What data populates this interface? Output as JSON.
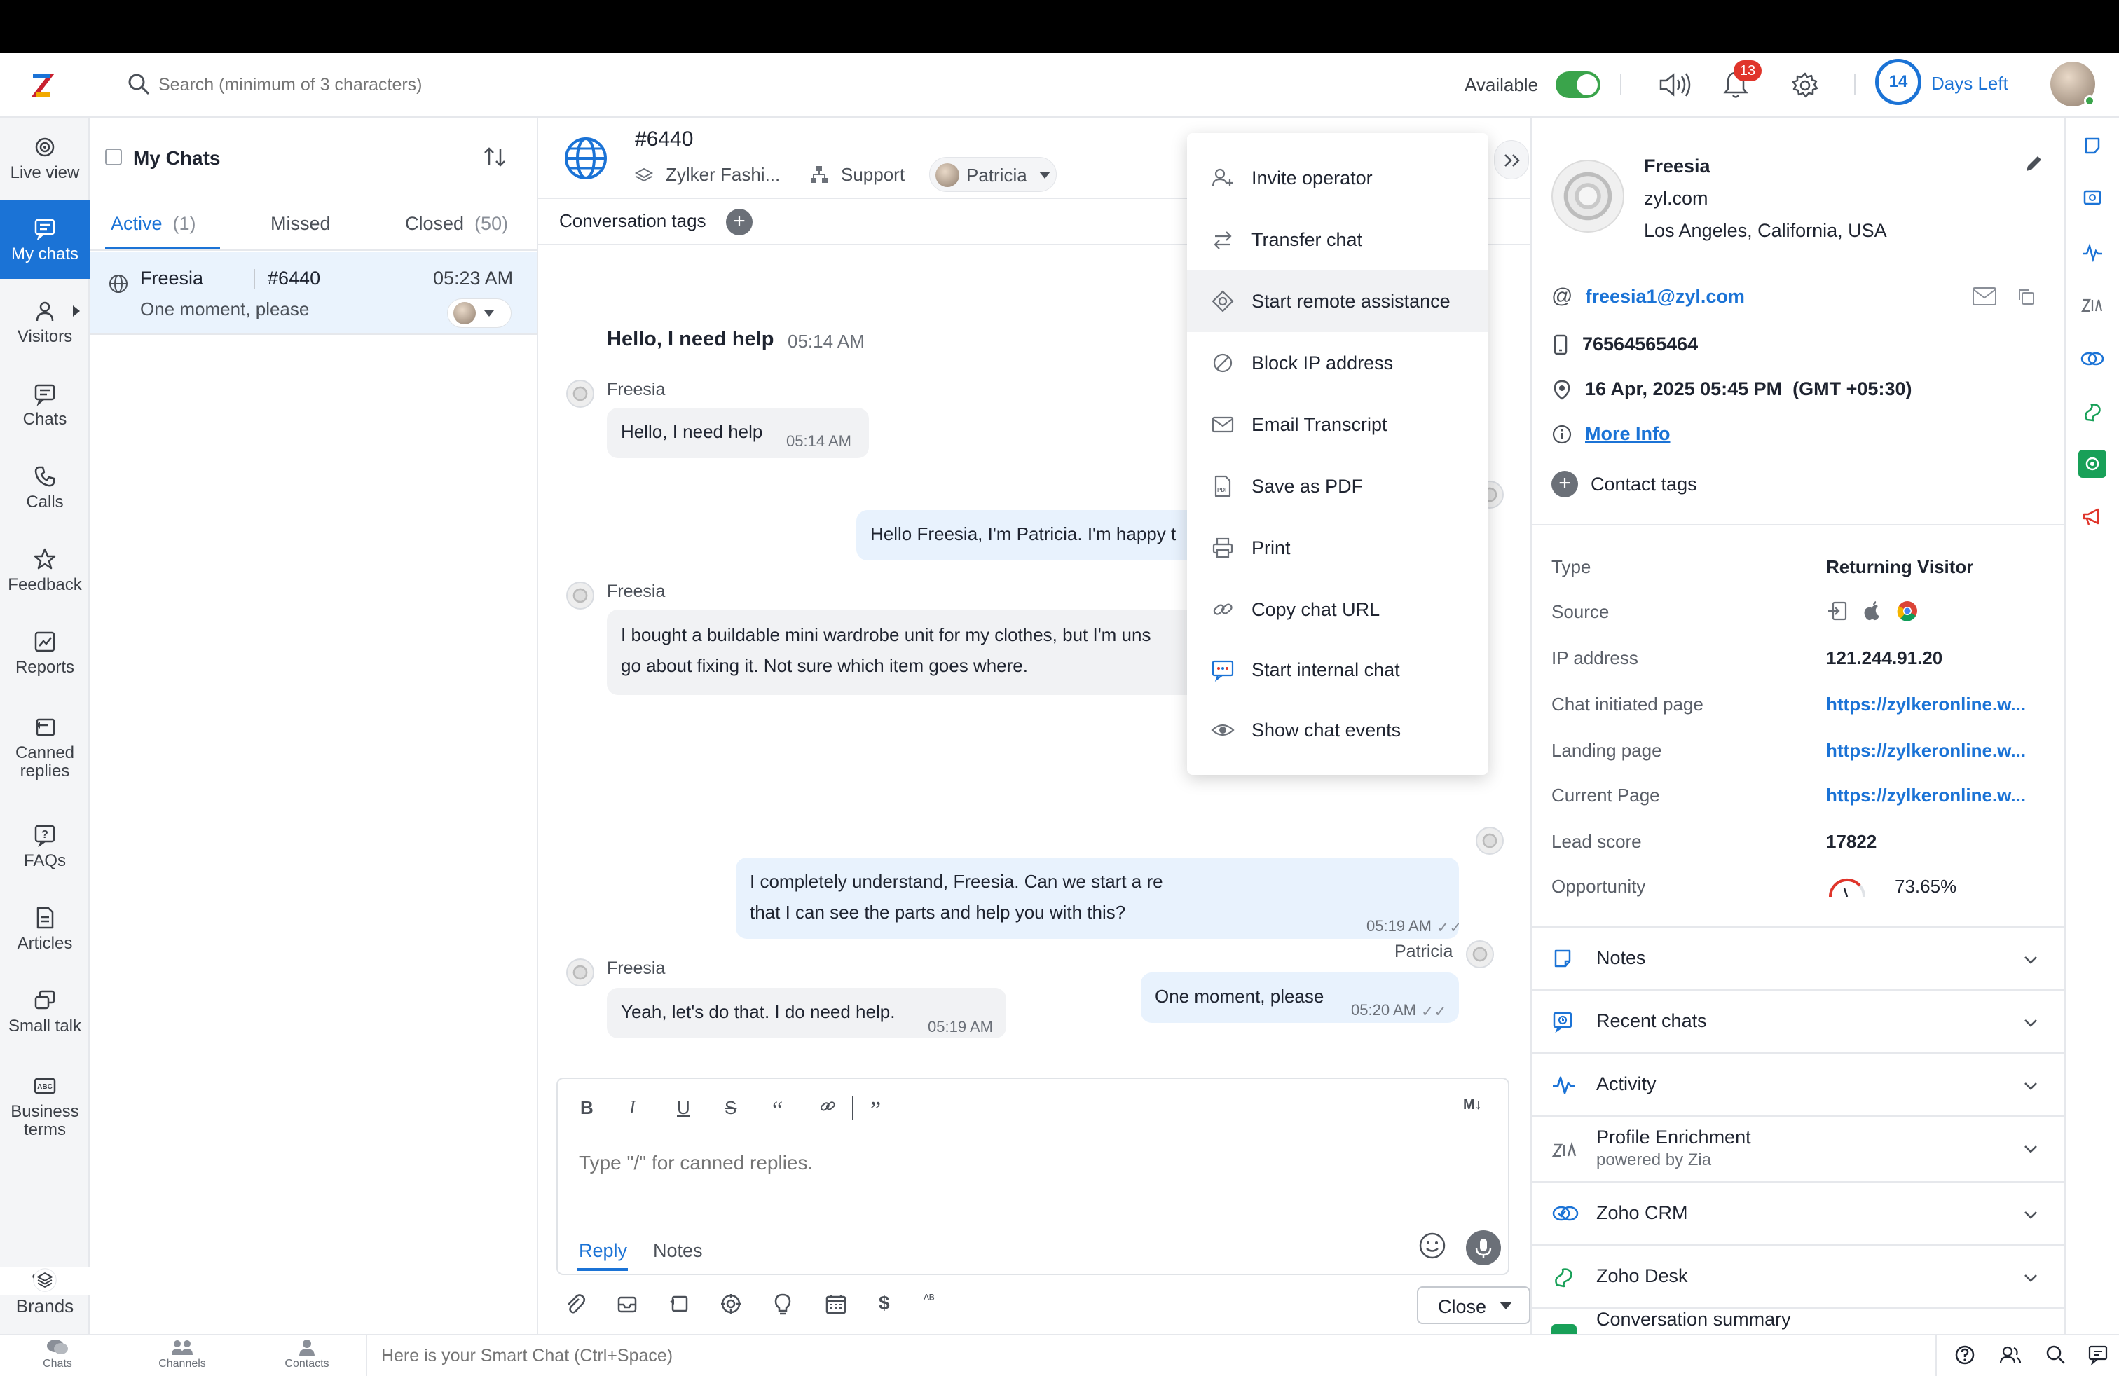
{
  "header": {
    "search_placeholder": "Search (minimum of 3 characters)",
    "availability_label": "Available",
    "notification_count": "13",
    "trial_days": "14",
    "trial_label": "Days Left"
  },
  "nav": {
    "items": [
      {
        "label": "Live view",
        "icon": "live-view-icon"
      },
      {
        "label": "My chats",
        "icon": "chat-bubble-icon"
      },
      {
        "label": "Visitors",
        "icon": "person-icon"
      },
      {
        "label": "Chats",
        "icon": "chats-icon"
      },
      {
        "label": "Calls",
        "icon": "phone-icon"
      },
      {
        "label": "Feedback",
        "icon": "star-icon"
      },
      {
        "label": "Reports",
        "icon": "chart-icon"
      },
      {
        "label": "Canned replies",
        "icon": "canned-reply-icon"
      },
      {
        "label": "FAQs",
        "icon": "faq-icon"
      },
      {
        "label": "Articles",
        "icon": "article-icon"
      },
      {
        "label": "Small talk",
        "icon": "small-talk-icon"
      },
      {
        "label": "Business terms",
        "icon": "abc-icon"
      }
    ],
    "more": "•••",
    "brands": "Brands"
  },
  "chatlist": {
    "title": "My Chats",
    "tabs": [
      {
        "label": "Active",
        "count": "(1)"
      },
      {
        "label": "Missed",
        "count": ""
      },
      {
        "label": "Closed",
        "count": "(50)"
      }
    ],
    "rows": [
      {
        "name": "Freesia",
        "id": "#6440",
        "time": "05:23 AM",
        "message": "One moment, please"
      }
    ]
  },
  "conversation": {
    "id": "#6440",
    "department": "Zylker Fashi...",
    "support": "Support",
    "assignee": "Patricia",
    "tags_label": "Conversation tags",
    "first_question": "Hello, I need help",
    "first_question_time": "05:14 AM",
    "messages": [
      {
        "sender": "Freesia",
        "text": "Hello, I need help",
        "time": "05:14 AM"
      },
      {
        "text": "Hello Freesia, I'm Patricia. I'm happy t"
      },
      {
        "sender": "Freesia",
        "text1": "I bought a buildable mini wardrobe unit for my clothes, but I'm uns",
        "text2": "go about fixing it. Not sure which item goes where."
      },
      {
        "text1": "I completely understand, Freesia. Can we start a re",
        "text2": "that I can see the parts and help you with this?",
        "time": "05:19 AM"
      },
      {
        "sender": "Freesia",
        "text": "Yeah, let's do that. I do need help.",
        "time": "05:19 AM"
      },
      {
        "sender": "Patricia",
        "text": "One moment, please",
        "time": "05:20 AM"
      }
    ]
  },
  "composer": {
    "placeholder": "Type \"/\" for canned replies.",
    "markdown": "M↓",
    "reply_tab": "Reply",
    "notes_tab": "Notes",
    "close_label": "Close"
  },
  "menu": {
    "items": [
      {
        "label": "Invite operator",
        "icon": "invite-operator-icon"
      },
      {
        "label": "Transfer chat",
        "icon": "transfer-icon"
      },
      {
        "label": "Start remote assistance",
        "icon": "remote-assistance-icon"
      },
      {
        "label": "Block IP address",
        "icon": "block-icon"
      },
      {
        "label": "Email Transcript",
        "icon": "mail-icon"
      },
      {
        "label": "Save as PDF",
        "icon": "pdf-icon"
      },
      {
        "label": "Print",
        "icon": "print-icon"
      },
      {
        "label": "Copy chat URL",
        "icon": "link-icon"
      },
      {
        "label": "Start internal chat",
        "icon": "internal-chat-icon"
      },
      {
        "label": "Show chat events",
        "icon": "eye-icon"
      }
    ]
  },
  "visitor": {
    "name": "Freesia",
    "domain": "zyl.com",
    "location": "Los Angeles, California, USA",
    "email": "freesia1@zyl.com",
    "phone": "76564565464",
    "local_time": "16 Apr, 2025 05:45 PM  (GMT +05:30)",
    "more_info": "More Info",
    "contact_tags": "Contact tags",
    "info": {
      "type_label": "Type",
      "type_value": "Returning Visitor",
      "source_label": "Source",
      "ip_label": "IP address",
      "ip_value": "121.244.91.20",
      "initiated_label": "Chat initiated page",
      "initiated_value": "https://zylkeronline.w...",
      "landing_label": "Landing page",
      "landing_value": "https://zylkeronline.w...",
      "current_label": "Current Page",
      "current_value": "https://zylkeronline.w...",
      "lead_label": "Lead score",
      "lead_value": "17822",
      "opportunity_label": "Opportunity",
      "opportunity_value": "73.65%"
    },
    "sections": [
      {
        "title": "Notes",
        "icon": "notes-icon"
      },
      {
        "title": "Recent chats",
        "icon": "recent-chats-icon"
      },
      {
        "title": "Activity",
        "icon": "activity-icon"
      },
      {
        "title": "Profile Enrichment",
        "subtitle": "powered by Zia",
        "icon": "zia-icon"
      },
      {
        "title": "Zoho CRM",
        "icon": "crm-icon"
      },
      {
        "title": "Zoho Desk",
        "icon": "desk-icon"
      },
      {
        "title": "Conversation summary",
        "icon": "summary-icon"
      }
    ]
  },
  "statusbar": {
    "items": [
      "Chats",
      "Channels",
      "Contacts"
    ],
    "smart_chat_placeholder": "Here is your Smart Chat (Ctrl+Space)"
  },
  "colors": {
    "accent": "#1b73d6",
    "online": "#3aa44b",
    "badge": "#e0352b"
  }
}
